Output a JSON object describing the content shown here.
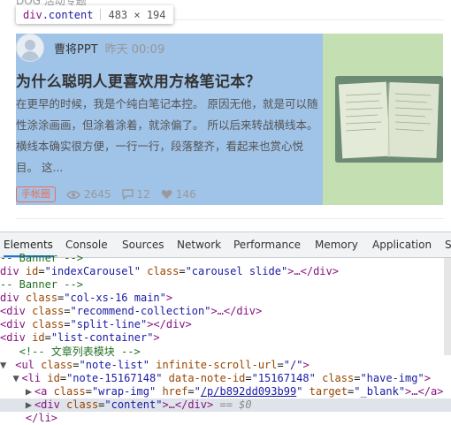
{
  "tooltip": {
    "tag": "div",
    "cls": ".content",
    "size": "483 × 194"
  },
  "top_cut_text": "DOG 活动专题",
  "article": {
    "author": "曹将PPT",
    "time": "昨天 00:09",
    "title": "为什么聪明人更喜欢用方格笔记本？",
    "abstract": "在更早的时候，我是个纯白笔记本控。 原因无他，就是可以随性涂涂画画，但涂着涂着，就涂偏了。 所以后来转战横线本。 横线本确实很方便，一行一行，段落整齐，看起来也赏心悦目。 这...",
    "tag": "手帐圈",
    "views": "2645",
    "comments": "12",
    "likes": "146"
  },
  "devtools": {
    "tabs": [
      "Elements",
      "Console",
      "Sources",
      "Network",
      "Performance",
      "Memory",
      "Application",
      "S"
    ],
    "active_tab": "Elements",
    "lines": {
      "l0": {
        "comment": "-- Banner -->"
      },
      "l1": {
        "open": "div",
        "attr1": "id",
        "val1": "\"indexCarousel\"",
        "attr2": "class",
        "val2": "\"carousel slide\"",
        "tail": ">…</div>"
      },
      "l2": {
        "comment": "-- Banner -->"
      },
      "l3": {
        "open": "div",
        "attr1": "class",
        "val1": "\"col-xs-16 main\"",
        "tail": ">"
      },
      "l4": {
        "open": "<div",
        "attr1": "class",
        "val1": "\"recommend-collection\"",
        "tail": ">…</div>"
      },
      "l5": {
        "open": "<div",
        "attr1": "class",
        "val1": "\"split-line\"",
        "tail": "></div>"
      },
      "l6": {
        "open": "<div",
        "attr1": "id",
        "val1": "\"list-container\"",
        "tail": ">"
      },
      "l7": {
        "comment": "<!-- 文章列表模块 -->"
      },
      "l8": {
        "open": "<ul",
        "attr1": "class",
        "val1": "\"note-list\"",
        "attr2": "infinite-scroll-url",
        "val2": "\"/\"",
        "tail": ">"
      },
      "l9": {
        "open": "<li",
        "attr1": "id",
        "val1": "\"note-15167148\"",
        "attr2": "data-note-id",
        "val2": "\"15167148\"",
        "attr3": "class",
        "val3": "\"have-img\"",
        "tail": ">"
      },
      "l10": {
        "open": "<a",
        "attr1": "class",
        "val1": "\"wrap-img\"",
        "attr2": "href",
        "val2": "/p/b892dd093b99",
        "attr3": "target",
        "val3": "\"_blank\"",
        "tail": ">…</a>"
      },
      "l11": {
        "open": "<div",
        "attr1": "class",
        "val1": "\"content\"",
        "tail": ">…</div>",
        "eq": "== $0"
      },
      "l12": {
        "open": "</li>"
      }
    }
  }
}
